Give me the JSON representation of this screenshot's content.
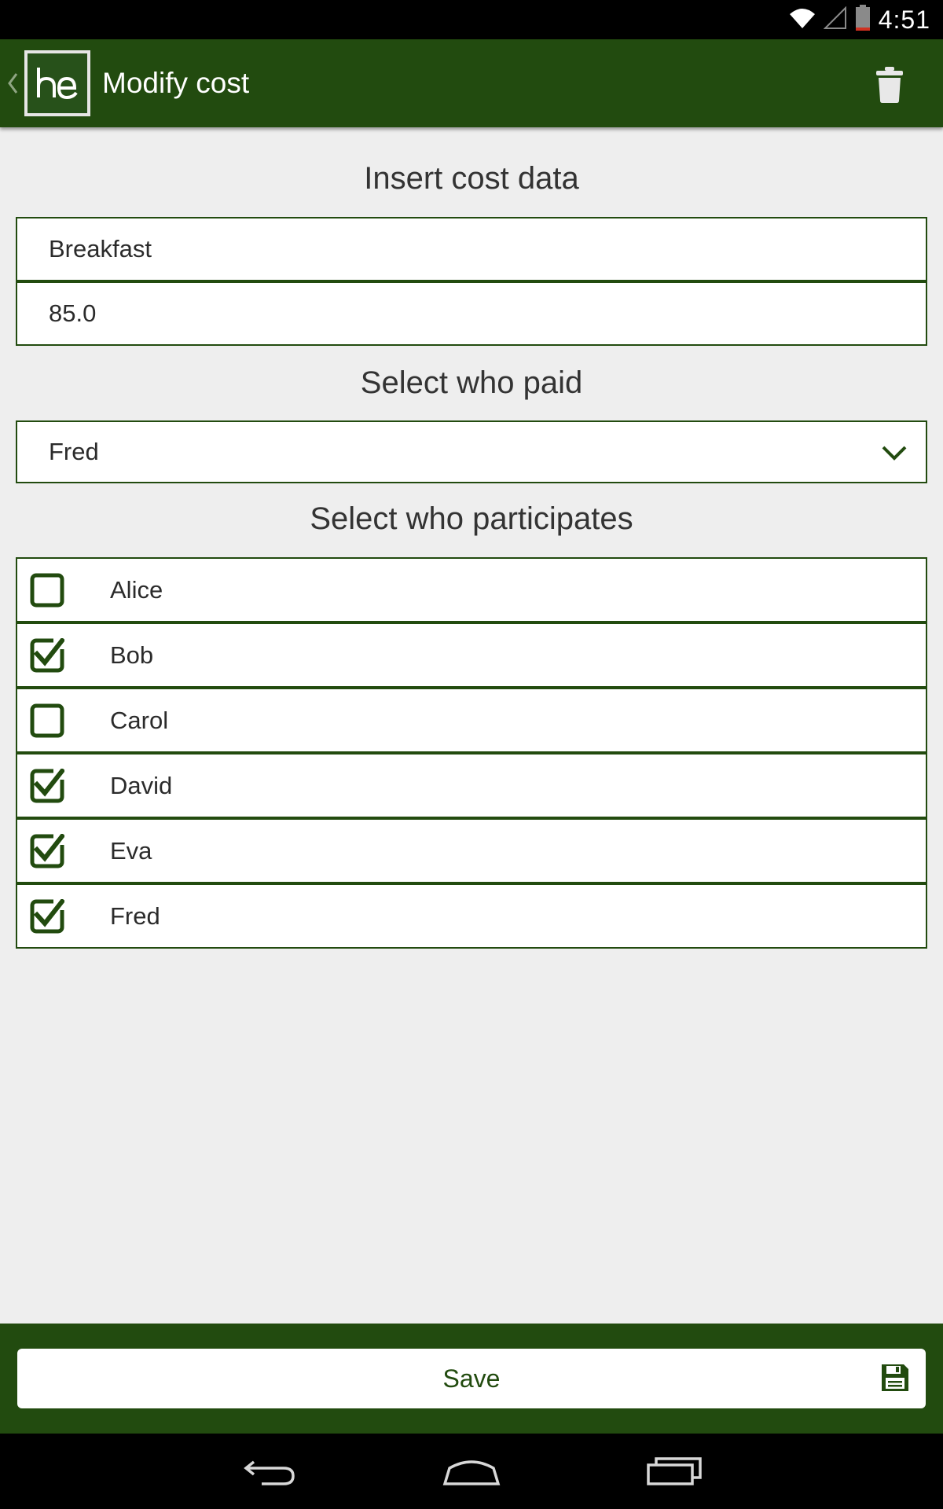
{
  "status_bar": {
    "time": "4:51"
  },
  "app_bar": {
    "logo_text": "hc",
    "title": "Modify cost",
    "delete_icon": "trash-icon"
  },
  "cost_section": {
    "title": "Insert cost data",
    "description_value": "Breakfast",
    "amount_value": "85.0"
  },
  "payer_section": {
    "title": "Select who paid",
    "selected": "Fred"
  },
  "participants_section": {
    "title": "Select who participates",
    "participants": [
      {
        "name": "Alice",
        "checked": false
      },
      {
        "name": "Bob",
        "checked": true
      },
      {
        "name": "Carol",
        "checked": false
      },
      {
        "name": "David",
        "checked": true
      },
      {
        "name": "Eva",
        "checked": true
      },
      {
        "name": "Fred",
        "checked": true
      }
    ]
  },
  "footer": {
    "save_label": "Save",
    "save_icon": "floppy-disk-icon"
  },
  "colors": {
    "primary": "#224b0f",
    "background": "#eeeeee",
    "surface": "#ffffff"
  }
}
